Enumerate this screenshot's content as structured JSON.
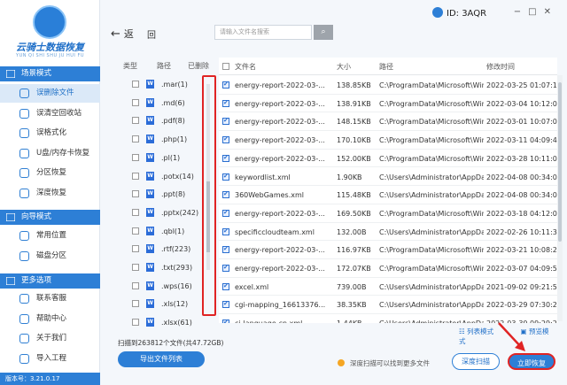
{
  "app": {
    "name": "云骑士数据恢复",
    "subname": "YUN QI SHI SHU JU HUI FU",
    "version": "版本号：3.21.0.17"
  },
  "sidebar": {
    "sections": [
      {
        "label": "场景模式",
        "items": [
          "误删除文件",
          "误清空回收站",
          "误格式化",
          "U盘/内存卡恢复",
          "分区恢复",
          "深度恢复"
        ]
      },
      {
        "label": "向导模式",
        "items": [
          "常用位置",
          "磁盘分区"
        ]
      },
      {
        "label": "更多选项",
        "items": [
          "联系客服",
          "帮助中心",
          "关于我们",
          "导入工程"
        ]
      }
    ]
  },
  "topbar": {
    "back": "返",
    "root": "回",
    "search_placeholder": "请输入文件名搜索",
    "search_icon": "search-icon",
    "user_id": "ID: 3AQR",
    "window_controls": [
      "−",
      "□",
      "✕"
    ]
  },
  "tree": {
    "headers": [
      "类型",
      "路径",
      "已删除"
    ],
    "items": [
      ".mar(1)",
      ".md(6)",
      ".pdf(8)",
      ".php(1)",
      ".pl(1)",
      ".potx(14)",
      ".ppt(8)",
      ".pptx(242)",
      ".qbl(1)",
      ".rtf(223)",
      ".txt(293)",
      ".wps(16)",
      ".xls(12)",
      ".xlsx(61)"
    ]
  },
  "filelist": {
    "headers": [
      "文件名",
      "大小",
      "路径",
      "修改时间"
    ],
    "rows": [
      {
        "name": "energy-report-2022-03-...",
        "size": "138.85KB",
        "path": "C:\\ProgramData\\Microsoft\\Wind...",
        "time": "2022-03-25 01:07:19"
      },
      {
        "name": "energy-report-2022-03-...",
        "size": "138.91KB",
        "path": "C:\\ProgramData\\Microsoft\\Wind...",
        "time": "2022-03-04 10:12:00"
      },
      {
        "name": "energy-report-2022-03-...",
        "size": "148.15KB",
        "path": "C:\\ProgramData\\Microsoft\\Wind...",
        "time": "2022-03-01 10:07:09"
      },
      {
        "name": "energy-report-2022-03-...",
        "size": "170.10KB",
        "path": "C:\\ProgramData\\Microsoft\\Wind...",
        "time": "2022-03-11 04:09:49"
      },
      {
        "name": "energy-report-2022-03-...",
        "size": "152.00KB",
        "path": "C:\\ProgramData\\Microsoft\\Wind...",
        "time": "2022-03-28 10:11:03"
      },
      {
        "name": "keywordlist.xml",
        "size": "1.90KB",
        "path": "C:\\Users\\Administrator\\AppData...",
        "time": "2022-04-08 00:34:01"
      },
      {
        "name": "360WebGames.xml",
        "size": "115.48KB",
        "path": "C:\\Users\\Administrator\\AppData...",
        "time": "2022-04-08 00:34:00"
      },
      {
        "name": "energy-report-2022-03-...",
        "size": "169.50KB",
        "path": "C:\\ProgramData\\Microsoft\\Wind...",
        "time": "2022-03-18 04:12:09"
      },
      {
        "name": "specificcloudteam.xml",
        "size": "132.00B",
        "path": "C:\\Users\\Administrator\\AppData...",
        "time": "2022-02-26 10:11:34"
      },
      {
        "name": "energy-report-2022-03-...",
        "size": "116.97KB",
        "path": "C:\\ProgramData\\Microsoft\\Wind...",
        "time": "2022-03-21 10:08:29"
      },
      {
        "name": "energy-report-2022-03-...",
        "size": "172.07KB",
        "path": "C:\\ProgramData\\Microsoft\\Wind...",
        "time": "2022-03-07 04:09:55"
      },
      {
        "name": "excel.xml",
        "size": "739.00B",
        "path": "C:\\Users\\Administrator\\AppData...",
        "time": "2021-09-02 09:21:52"
      },
      {
        "name": "cgi-mapping_16613376...",
        "size": "38.35KB",
        "path": "C:\\Users\\Administrator\\AppData...",
        "time": "2022-03-29 07:30:23"
      },
      {
        "name": "ci-language-cn.xml",
        "size": "1.44KB",
        "path": "C:\\Users\\Administrator\\AppData...",
        "time": "2022-03-30 09:29:24"
      }
    ]
  },
  "bottom": {
    "scan_summary": "扫描到263812个文件(共47.72GB)",
    "export_label": "导出文件列表",
    "list_mode": "列表模式",
    "preview_mode": "预览模式",
    "hint": "深度扫描可以找到更多文件",
    "deep_scan": "深度扫描",
    "recover": "立即恢复"
  },
  "colors": {
    "accent": "#2d7fd6",
    "highlight": "#e02424"
  }
}
